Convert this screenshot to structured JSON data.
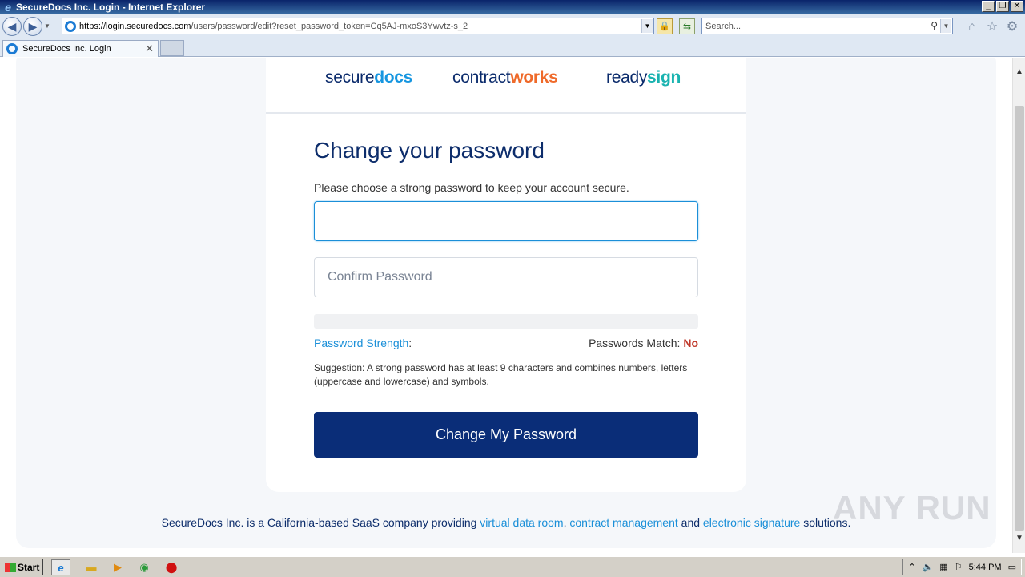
{
  "window": {
    "title": "SecureDocs Inc. Login - Internet Explorer",
    "ie_logo": "e",
    "buttons": {
      "minimize": "_",
      "restore": "❐",
      "close": "✕"
    }
  },
  "navbar": {
    "url_host": "https://login.securedocs.com",
    "url_path": "/users/password/edit?reset_password_token=Cq5AJ-mxoS3Ywvtz-s_2",
    "search_placeholder": "Search..."
  },
  "tabs": [
    {
      "label": "SecureDocs Inc. Login"
    }
  ],
  "logos": {
    "securedocs": {
      "prefix": "secure",
      "accent": "docs"
    },
    "contractworks": {
      "prefix": "contract",
      "accent": "works"
    },
    "readysign": {
      "prefix": "ready",
      "accent": "sign"
    }
  },
  "form": {
    "title": "Change your password",
    "subtitle": "Please choose a strong password to keep your account secure.",
    "password_value": "",
    "confirm_placeholder": "Confirm Password",
    "strength_label": "Password Strength",
    "strength_colon": ":",
    "match_label": "Passwords Match: ",
    "match_value": "No",
    "suggestion": "Suggestion: A strong password has at least 9 characters and combines numbers, letters (uppercase and lowercase) and symbols.",
    "submit_label": "Change My Password"
  },
  "footer": {
    "text1": "SecureDocs Inc. is a California-based SaaS company providing ",
    "link1": "virtual data room",
    "sep1": ", ",
    "link2": "contract management",
    "text2": " and ",
    "link3": "electronic signature",
    "text3": " solutions."
  },
  "watermark": "ANY RUN",
  "taskbar": {
    "start_label": "Start",
    "clock": "5:44 PM"
  },
  "colors": {
    "brand_navy": "#0a2d78",
    "link_blue": "#1a8fd8",
    "error_red": "#c0392b",
    "accent_orange": "#ef6a2a",
    "accent_teal": "#1ab3b0"
  }
}
